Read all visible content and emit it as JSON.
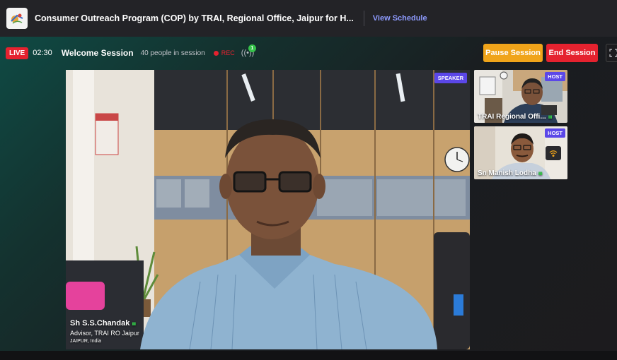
{
  "header": {
    "title": "Consumer Outreach Program (COP) by TRAI, Regional Office, Jaipur for H...",
    "view_schedule": "View Schedule"
  },
  "session": {
    "live_label": "LIVE",
    "timer": "02:30",
    "name": "Welcome Session",
    "people": "40 people in session",
    "rec_label": "REC",
    "signal_count": "1",
    "pause_label": "Pause Session",
    "end_label": "End Session"
  },
  "main_speaker": {
    "tag": "SPEAKER",
    "name": "Sh S.S.Chandak",
    "role": "Advisor, TRAI RO Jaipur",
    "location": "JAIPUR, India"
  },
  "participants": [
    {
      "tag": "HOST",
      "name": "TRAI Regional Offi..."
    },
    {
      "tag": "HOST",
      "name": "Sn Manish Lodha"
    }
  ],
  "colors": {
    "live": "#e5222f",
    "pause": "#f0a41a",
    "end": "#e5222f",
    "tag": "#5b47e8",
    "link": "#8e9bff"
  },
  "icons": [
    "event-logo-icon",
    "record-dot-icon",
    "broadcast-signal-icon",
    "fullscreen-icon",
    "audio-level-icon",
    "wifi-icon"
  ]
}
